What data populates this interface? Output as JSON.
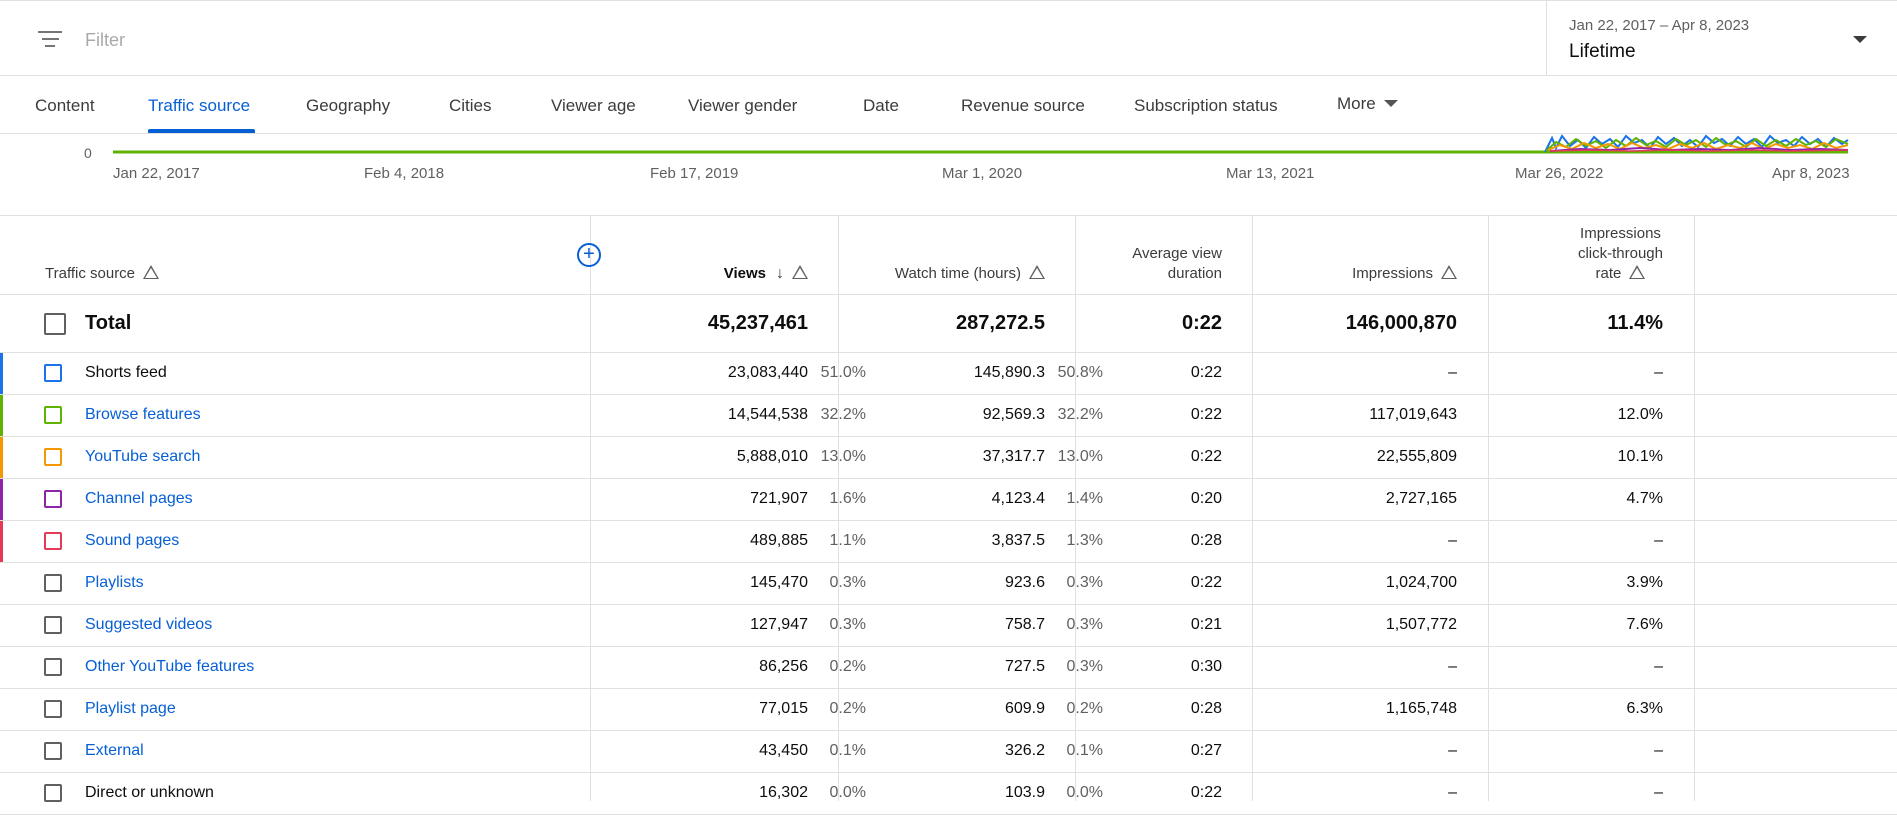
{
  "filter": {
    "placeholder": "Filter"
  },
  "date_picker": {
    "range": "Jan 22, 2017 – Apr 8, 2023",
    "period": "Lifetime"
  },
  "tabs": [
    {
      "label": "Content",
      "active": false
    },
    {
      "label": "Traffic source",
      "active": true
    },
    {
      "label": "Geography",
      "active": false
    },
    {
      "label": "Cities",
      "active": false
    },
    {
      "label": "Viewer age",
      "active": false
    },
    {
      "label": "Viewer gender",
      "active": false
    },
    {
      "label": "Date",
      "active": false
    },
    {
      "label": "Revenue source",
      "active": false
    },
    {
      "label": "Subscription status",
      "active": false
    }
  ],
  "more_label": "More",
  "chart_data": {
    "type": "line",
    "y_zero_label": "0",
    "x_tick_labels": [
      "Jan 22, 2017",
      "Feb 4, 2018",
      "Feb 17, 2019",
      "Mar 1, 2020",
      "Mar 13, 2021",
      "Mar 26, 2022",
      "Apr 8, 2023"
    ]
  },
  "table": {
    "headers": {
      "source": "Traffic source",
      "views": "Views",
      "watch_time": "Watch time (hours)",
      "avd_line1": "Average view",
      "avd_line2": "duration",
      "impressions": "Impressions",
      "ctr_line1": "Impressions",
      "ctr_line2": "click-through",
      "ctr_line3": "rate"
    },
    "total": {
      "label": "Total",
      "views": "45,237,461",
      "watch_time": "287,272.5",
      "avd": "0:22",
      "impressions": "146,000,870",
      "ctr": "11.4%"
    },
    "rows": [
      {
        "label": "Shorts feed",
        "link": false,
        "color": "#1a73e8",
        "views": "23,083,440",
        "views_pct": "51.0%",
        "watch_time": "145,890.3",
        "watch_pct": "50.8%",
        "avd": "0:22",
        "impressions": "–",
        "ctr": "–"
      },
      {
        "label": "Browse features",
        "link": true,
        "color": "#5fb300",
        "views": "14,544,538",
        "views_pct": "32.2%",
        "watch_time": "92,569.3",
        "watch_pct": "32.2%",
        "avd": "0:22",
        "impressions": "117,019,643",
        "ctr": "12.0%"
      },
      {
        "label": "YouTube search",
        "link": true,
        "color": "#f29900",
        "views": "5,888,010",
        "views_pct": "13.0%",
        "watch_time": "37,317.7",
        "watch_pct": "13.0%",
        "avd": "0:22",
        "impressions": "22,555,809",
        "ctr": "10.1%"
      },
      {
        "label": "Channel pages",
        "link": true,
        "color": "#8e24aa",
        "views": "721,907",
        "views_pct": "1.6%",
        "watch_time": "4,123.4",
        "watch_pct": "1.4%",
        "avd": "0:20",
        "impressions": "2,727,165",
        "ctr": "4.7%"
      },
      {
        "label": "Sound pages",
        "link": true,
        "color": "#e53958",
        "views": "489,885",
        "views_pct": "1.1%",
        "watch_time": "3,837.5",
        "watch_pct": "1.3%",
        "avd": "0:28",
        "impressions": "–",
        "ctr": "–"
      },
      {
        "label": "Playlists",
        "link": true,
        "color": "",
        "views": "145,470",
        "views_pct": "0.3%",
        "watch_time": "923.6",
        "watch_pct": "0.3%",
        "avd": "0:22",
        "impressions": "1,024,700",
        "ctr": "3.9%"
      },
      {
        "label": "Suggested videos",
        "link": true,
        "color": "",
        "views": "127,947",
        "views_pct": "0.3%",
        "watch_time": "758.7",
        "watch_pct": "0.3%",
        "avd": "0:21",
        "impressions": "1,507,772",
        "ctr": "7.6%"
      },
      {
        "label": "Other YouTube features",
        "link": true,
        "color": "",
        "views": "86,256",
        "views_pct": "0.2%",
        "watch_time": "727.5",
        "watch_pct": "0.3%",
        "avd": "0:30",
        "impressions": "–",
        "ctr": "–"
      },
      {
        "label": "Playlist page",
        "link": true,
        "color": "",
        "views": "77,015",
        "views_pct": "0.2%",
        "watch_time": "609.9",
        "watch_pct": "0.2%",
        "avd": "0:28",
        "impressions": "1,165,748",
        "ctr": "6.3%"
      },
      {
        "label": "External",
        "link": true,
        "color": "",
        "views": "43,450",
        "views_pct": "0.1%",
        "watch_time": "326.2",
        "watch_pct": "0.1%",
        "avd": "0:27",
        "impressions": "–",
        "ctr": "–"
      },
      {
        "label": "Direct or unknown",
        "link": false,
        "color": "",
        "views": "16,302",
        "views_pct": "0.0%",
        "watch_time": "103.9",
        "watch_pct": "0.0%",
        "avd": "0:22",
        "impressions": "–",
        "ctr": "–"
      }
    ]
  }
}
